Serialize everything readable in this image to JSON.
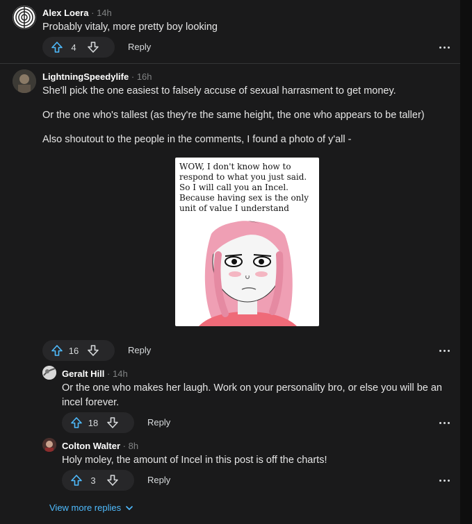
{
  "comments": [
    {
      "author": "Alex Loera",
      "time": "14h",
      "paragraphs": [
        "Probably vitaly, more pretty boy looking"
      ],
      "votes": "4",
      "reply_label": "Reply"
    },
    {
      "author": "LightningSpeedylife",
      "time": "16h",
      "paragraphs": [
        "She'll pick the one easiest to falsely accuse of sexual harrasment to get money.",
        "Or the one who's tallest (as they're the same height, the one who appears to be taller)",
        "Also shoutout to the people in the comments, I found a photo of y'all -"
      ],
      "image_text": "WOW, I don't know how to respond to what you just said. So I will call you an Incel. Because having sex is the only unit of value I understand",
      "votes": "16",
      "reply_label": "Reply"
    },
    {
      "author": "Geralt Hill",
      "time": "14h",
      "paragraphs": [
        "Or the one who makes her laugh. Work on your personality bro, or else you will be an incel forever."
      ],
      "votes": "18",
      "reply_label": "Reply"
    },
    {
      "author": "Colton Walter",
      "time": "8h",
      "paragraphs": [
        "Holy moley, the amount of Incel in this post is off the charts!"
      ],
      "votes": "3",
      "reply_label": "Reply"
    }
  ],
  "separator": "·",
  "view_more_label": "View more replies",
  "colors": {
    "background": "#1a1a1b",
    "upvote": "#4fbcff",
    "link": "#4fbcff",
    "text": "#d7dadc",
    "muted": "#818384"
  },
  "icons": {
    "upvote": "arrow-up-outline-icon",
    "downvote": "arrow-down-outline-icon",
    "more": "ellipsis-horizontal-icon",
    "expand": "chevron-down-icon"
  }
}
